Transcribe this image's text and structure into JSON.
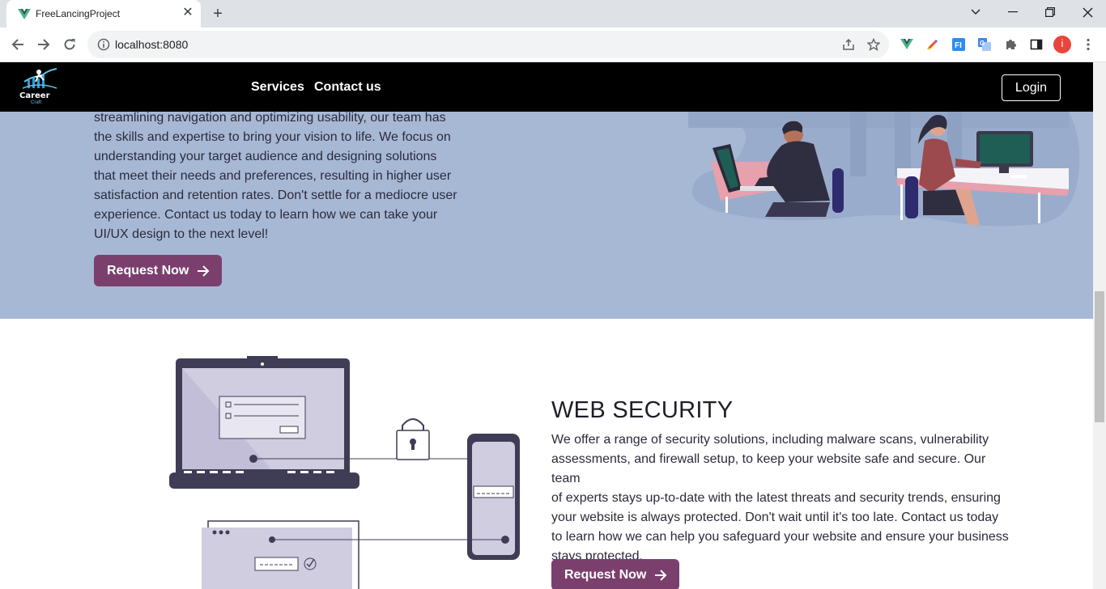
{
  "browser": {
    "tab_title": "FreeLancingProject",
    "url": "localhost:8080",
    "profile_initial": "i",
    "accent_profile": "#e8453c"
  },
  "nav": {
    "logo_text": "Career",
    "logo_subtext": "Craft",
    "links": [
      "Services",
      "Contact us"
    ],
    "login_label": "Login"
  },
  "uiux": {
    "lines": [
      "streamlining navigation and optimizing usability, our team has",
      "the skills and expertise to bring your vision to life. We focus on",
      "understanding your target audience and designing solutions",
      "that meet their needs and preferences, resulting in higher user",
      "satisfaction and retention rates. Don't settle for a mediocre user",
      "experience. Contact us today to learn how we can take your",
      "UI/UX design to the next level!"
    ],
    "button_label": "Request Now",
    "bg_color": "#a7b8d5"
  },
  "security": {
    "title": "WEB SECURITY",
    "lines": [
      "We offer a range of security solutions, including malware scans, vulnerability",
      "assessments, and firewall setup, to keep your website safe and secure. Our team",
      "of experts stays up-to-date with the latest threats and security trends, ensuring",
      "your website is always protected. Don't wait until it's too late. Contact us today",
      "to learn how we can help you safeguard your website and ensure your business",
      "stays protected."
    ],
    "button_label": "Request Now",
    "button_color": "#7b3f6e"
  }
}
